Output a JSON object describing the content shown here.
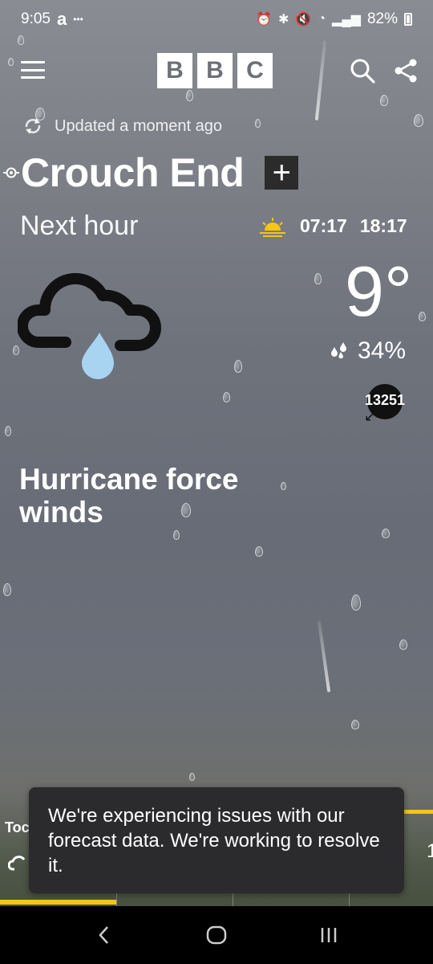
{
  "status_bar": {
    "time": "9:05",
    "app_badge": "a",
    "dots": "•••",
    "battery": "82%"
  },
  "header": {
    "logo_letters": [
      "B",
      "B",
      "C"
    ]
  },
  "updated_text": "Updated a moment ago",
  "location": {
    "name": "Crouch End",
    "add_symbol": "+"
  },
  "forecast": {
    "period_label": "Next hour",
    "sunrise": "07:17",
    "sunset": "18:17",
    "temperature": "9°",
    "precipitation": "34%",
    "wind_speed": "13251",
    "wind_arrow": "↙",
    "description": "Hurricane force winds",
    "weather_icon": "cloud-rain-icon"
  },
  "bottom": {
    "today_label": "Toc",
    "right_digit": "1"
  },
  "toast": {
    "message": "We're experiencing issues with our forecast data. We're working to resolve it."
  },
  "colors": {
    "accent": "#f5c518",
    "toast_bg": "#2b2b2d",
    "rain_drop": "#a8d4f2"
  }
}
